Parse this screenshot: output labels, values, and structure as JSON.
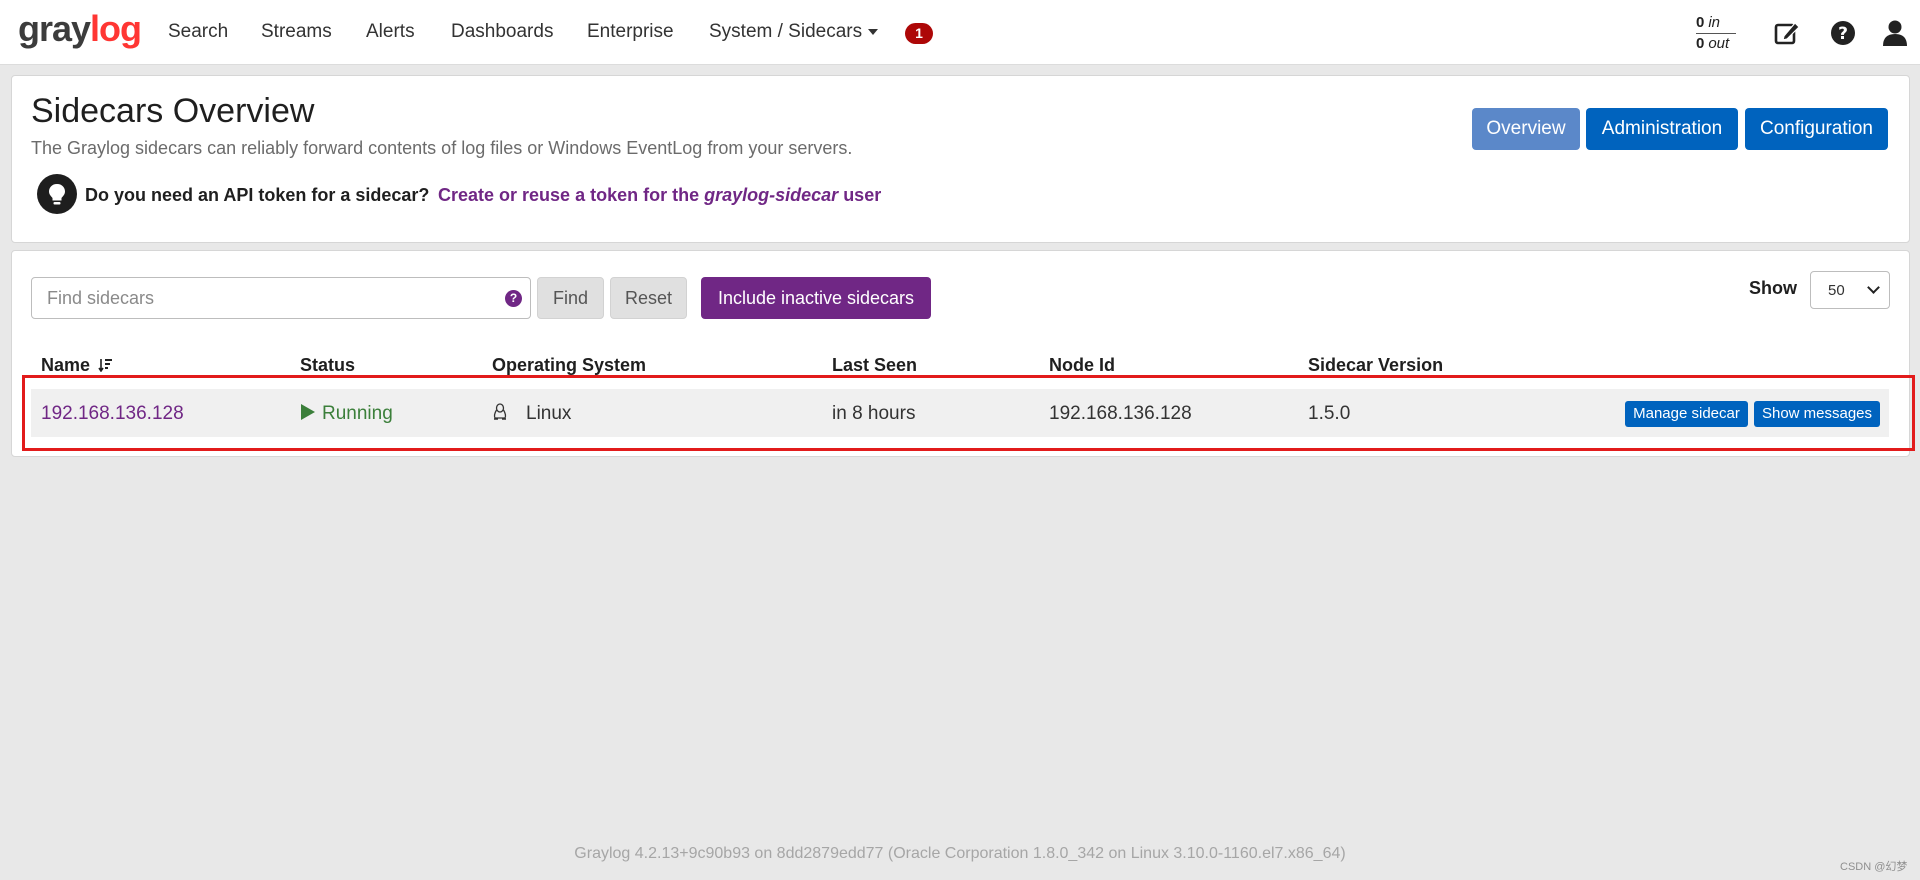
{
  "navbar": {
    "brand_prefix": "gray",
    "brand_suffix": "log",
    "items": [
      {
        "label": "Search"
      },
      {
        "label": "Streams"
      },
      {
        "label": "Alerts"
      },
      {
        "label": "Dashboards"
      },
      {
        "label": "Enterprise"
      },
      {
        "label": "System / Sidecars"
      }
    ],
    "notification_count": "1",
    "throughput": {
      "in_value": "0",
      "in_label": "in",
      "out_value": "0",
      "out_label": "out"
    },
    "icons": [
      "edit-icon",
      "help-icon",
      "user-icon"
    ]
  },
  "header": {
    "title": "Sidecars Overview",
    "description": "The Graylog sidecars can reliably forward contents of log files or Windows EventLog from your servers.",
    "token_question": "Do you need an API token for a sidecar?",
    "token_link_prefix": "Create or reuse a token for the",
    "token_link_user": "graylog-sidecar",
    "token_link_suffix": "user",
    "buttons": {
      "overview": "Overview",
      "administration": "Administration",
      "configuration": "Configuration"
    }
  },
  "search": {
    "placeholder": "Find sidecars",
    "value": "",
    "help": "?",
    "find_label": "Find",
    "reset_label": "Reset",
    "include_inactive_label": "Include inactive sidecars"
  },
  "show": {
    "label": "Show",
    "selected": "50"
  },
  "table": {
    "headers": [
      "Name",
      "Status",
      "Operating System",
      "Last Seen",
      "Node Id",
      "Sidecar Version"
    ],
    "rows": [
      {
        "name": "192.168.136.128",
        "status": "Running",
        "os": "Linux",
        "last_seen": "in 8 hours",
        "node_id": "192.168.136.128",
        "version": "1.5.0",
        "manage_label": "Manage sidecar",
        "messages_label": "Show messages"
      }
    ]
  },
  "footer": "Graylog 4.2.13+9c90b93 on 8dd2879edd77 (Oracle Corporation 1.8.0_342 on Linux 3.10.0-1160.el7.x86_64)",
  "watermark": "CSDN @幻梦",
  "colors": {
    "primary": "#0063be",
    "purple": "#702785",
    "success": "#3b7f3a",
    "badge": "#ad0707",
    "highlight": "#e21b1b"
  }
}
